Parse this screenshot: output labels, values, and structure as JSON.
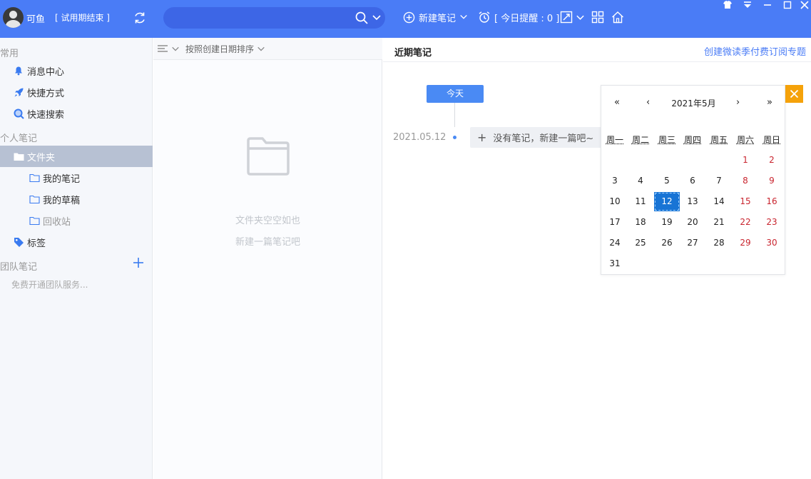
{
  "topbar": {
    "username": "可鱼",
    "trial_label": "[ 试用期结束 ]",
    "search_placeholder": "",
    "new_note_label": "新建笔记",
    "reminder_label": "[ 今日提醒 : 0 ]",
    "accent": "#4a7cf6"
  },
  "sidebar": {
    "common_label": "常用",
    "common_items": [
      {
        "label": "消息中心",
        "icon": "bell-icon"
      },
      {
        "label": "快捷方式",
        "icon": "rocket-icon"
      },
      {
        "label": "快速搜索",
        "icon": "search-icon"
      }
    ],
    "personal_label": "个人笔记",
    "folder_label": "文件夹",
    "folder_children": [
      "我的笔记",
      "我的草稿",
      "回收站"
    ],
    "tags_label": "标签",
    "team_label": "团队笔记",
    "team_hint": "免费开通团队服务..."
  },
  "notelist": {
    "sort_label": "按照创建日期排序",
    "empty_line1": "文件夹空空如也",
    "empty_line2": "新建一篇笔记吧"
  },
  "main": {
    "title": "近期笔记",
    "subscribe_link": "创建微读季付费订阅专题",
    "today_button": "今天",
    "timeline_date": "2021.05.12",
    "new_note_chip": "没有笔记，新建一篇吧~"
  },
  "calendar": {
    "prev_year": "«",
    "prev_month": "‹",
    "next_month": "›",
    "next_year": "»",
    "month_label": "2021年5月",
    "weekdays": [
      "周一",
      "周二",
      "周三",
      "周四",
      "周五",
      "周六",
      "周日"
    ],
    "first_weekday_index": 5,
    "days_in_month": 31,
    "selected_day": 12,
    "weekend_color": "#c9252f",
    "selected_color": "#1874d5"
  }
}
